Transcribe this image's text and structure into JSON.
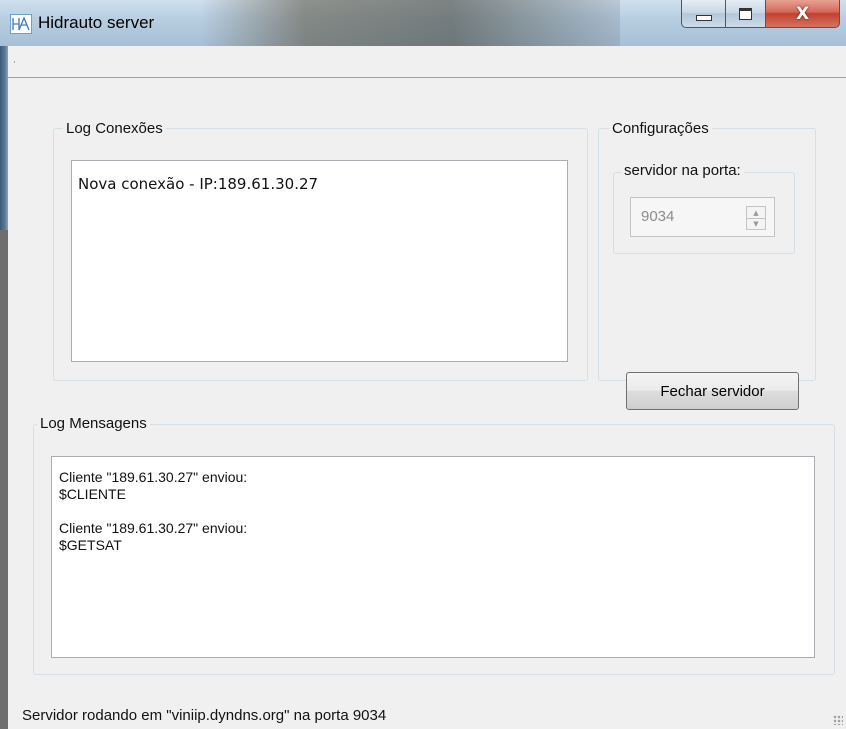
{
  "window": {
    "title": "Hidrauto server",
    "controls": {
      "minimize": "minimize",
      "maximize": "maximize",
      "close": "X"
    }
  },
  "log_conexoes": {
    "title": "Log Conexões",
    "entries": [
      "Nova conexão - IP:189.61.30.27"
    ]
  },
  "configuracoes": {
    "title": "Configurações",
    "porta_group_title": "servidor na porta:",
    "porta_value": "9034",
    "fechar_button": "Fechar servidor"
  },
  "log_mensagens": {
    "title": "Log Mensagens",
    "messages": [
      {
        "header": "Cliente \"189.61.30.27\" enviou:",
        "body": "$CLIENTE"
      },
      {
        "header": "Cliente \"189.61.30.27\" enviou:",
        "body": "$GETSAT"
      }
    ]
  },
  "status_bar": {
    "text": "Servidor rodando em \"viniip.dyndns.org\" na porta 9034"
  },
  "icons": [
    "app-icon",
    "minimize-icon",
    "maximize-icon",
    "close-icon",
    "spin-up-icon",
    "spin-down-icon",
    "resize-grip-icon"
  ]
}
